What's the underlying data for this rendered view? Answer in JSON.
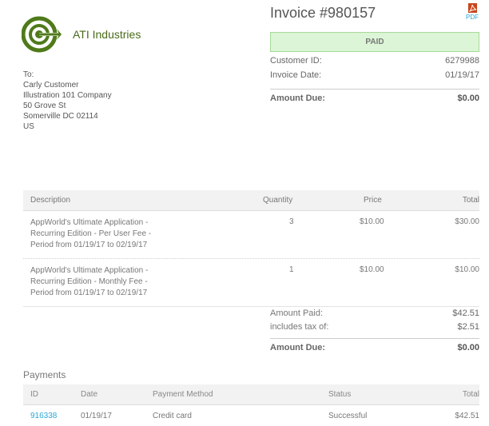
{
  "company": {
    "name": "ATI Industries",
    "logo_icon": "target-arrow-icon",
    "brand_color": "#4f7a1a"
  },
  "bill_to": {
    "label": "To:",
    "lines": [
      "Carly Customer",
      "Illustration 101 Company",
      "50 Grove St",
      "Somerville DC 02114",
      "US"
    ]
  },
  "invoice": {
    "title": "Invoice #980157",
    "pdf_label": "PDF",
    "pdf_icon": "pdf-file-icon",
    "status": "PAID",
    "status_color": "#dcf5d6",
    "customer_id_label": "Customer ID:",
    "customer_id": "6279988",
    "invoice_date_label": "Invoice Date:",
    "invoice_date": "01/19/17",
    "amount_due_label": "Amount Due:",
    "amount_due": "$0.00"
  },
  "items": {
    "columns": [
      "Description",
      "Quantity",
      "Price",
      "Total"
    ],
    "rows": [
      {
        "description": [
          "AppWorld's Ultimate Application -",
          "Recurring Edition - Per User Fee -",
          "Period from 01/19/17 to 02/19/17"
        ],
        "quantity": "3",
        "price": "$10.00",
        "total": "$30.00"
      },
      {
        "description": [
          "AppWorld's Ultimate Application -",
          "Recurring Edition - Monthly Fee -",
          "Period from 01/19/17 to 02/19/17"
        ],
        "quantity": "1",
        "price": "$10.00",
        "total": "$10.00"
      }
    ]
  },
  "totals": {
    "amount_paid_label": "Amount Paid:",
    "amount_paid": "$42.51",
    "tax_label": "includes tax of:",
    "tax": "$2.51",
    "amount_due_label": "Amount Due:",
    "amount_due": "$0.00"
  },
  "payments": {
    "title": "Payments",
    "columns": [
      "ID",
      "Date",
      "Payment Method",
      "Status",
      "Total"
    ],
    "rows": [
      {
        "id": "916338",
        "date": "01/19/17",
        "method": "Credit card",
        "status": "Successful",
        "total": "$42.51"
      }
    ],
    "link_color": "#2aa7d6"
  }
}
